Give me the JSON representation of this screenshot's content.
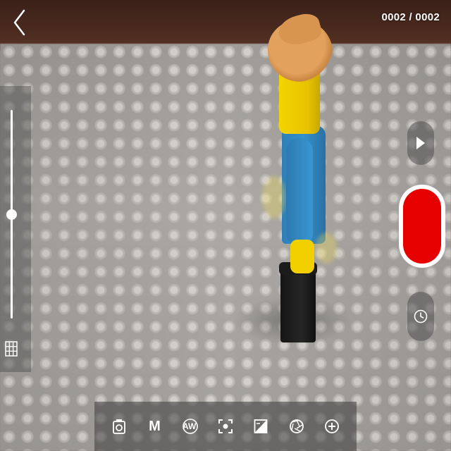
{
  "header": {
    "frame_counter": "0002 / 0002",
    "back_icon": "chevron-left-icon"
  },
  "zoom": {
    "level": 0.5
  },
  "side_controls": {
    "play_icon": "play-icon",
    "record_icon": "record-icon",
    "timer_icon": "clock-icon",
    "record_color": "#e60000"
  },
  "left_panel": {
    "grid_icon": "grid-icon"
  },
  "toolbar": {
    "items": [
      {
        "icon": "camera-icon",
        "label": ""
      },
      {
        "icon": "manual-focus-icon",
        "label": "M"
      },
      {
        "icon": "white-balance-icon",
        "label": "AW"
      },
      {
        "icon": "focus-frame-icon",
        "label": ""
      },
      {
        "icon": "exposure-icon",
        "label": ""
      },
      {
        "icon": "aperture-icon",
        "label": ""
      },
      {
        "icon": "add-icon",
        "label": ""
      }
    ]
  }
}
